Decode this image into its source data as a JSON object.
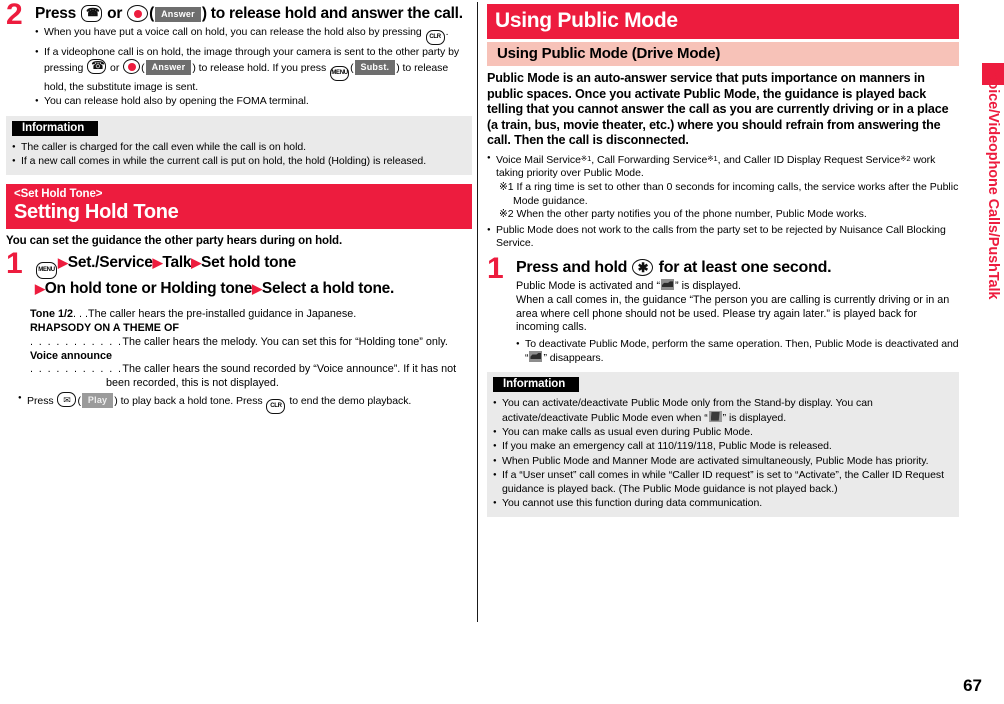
{
  "meta": {
    "page_number": "67",
    "edge_tab_label": "Voice/Videophone Calls/PushTalk",
    "accent_red": "#ED1C3E",
    "accent_pink": "#F7C2B8",
    "info_bg": "#EAEAEA",
    "chip_bg": "#6E6E6E"
  },
  "left": {
    "step2": {
      "number": "2",
      "title_a": "Press",
      "title_b": "or",
      "title_c": "(",
      "chip_answer": "Answer",
      "title_d": ") to release hold and answer the call.",
      "bullets": [
        {
          "part1": "When you have put a voice call on hold, you can release the hold also by pressing",
          "key": "CLR",
          "part2": "."
        },
        {
          "part1": "If a videophone call is on hold, the image through your camera is sent to the other party by pressing",
          "part2": "or",
          "chip1": "Answer",
          "part3": ") to release hold. If you press",
          "key_menu": "MENU",
          "chip2": "Subst.",
          "part4": ") to release hold, the substitute image is sent."
        },
        {
          "part1": "You can release hold also by opening the FOMA terminal."
        }
      ]
    },
    "information": {
      "label": "Information",
      "items": [
        "The caller is charged for the call even while the call is on hold.",
        "If a new call comes in while the current call is put on hold, the hold (Holding) is released."
      ]
    },
    "section": {
      "kicker": "<Set Hold Tone>",
      "title": "Setting Hold Tone",
      "lead": "You can set the guidance the other party hears during on hold.",
      "step1": {
        "number": "1",
        "key_menu": "MENU",
        "path": [
          "Set./Service",
          "Talk",
          "Set hold tone",
          "On hold tone or Holding tone",
          "Select a hold tone."
        ]
      },
      "definitions": [
        {
          "term": "Tone 1/2",
          "dots": ". . .",
          "desc": "The caller hears the pre-installed guidance in Japanese."
        },
        {
          "term": "RHAPSODY ON A THEME OF",
          "dots": ". . . . . . . . . . .",
          "desc": "The caller hears the melody. You can set this for “Holding tone” only."
        },
        {
          "term": "Voice announce",
          "dots": ". . . . . . . . . . .",
          "desc": "The caller hears the sound recorded by “Voice announce”. If it has not been recorded, this is not displayed."
        }
      ],
      "play_note": {
        "part1": "Press",
        "chip": "Play",
        "part2": ") to play back a hold tone. Press",
        "key": "CLR",
        "part3": "to end the demo playback."
      }
    }
  },
  "right": {
    "section_title": "Using Public Mode",
    "sub_title": "Using Public Mode (Drive Mode)",
    "lead": "Public Mode is an auto-answer service that puts importance on manners in public spaces. Once you activate Public Mode, the guidance is played back telling that you cannot answer the call as you are currently driving or in a place (a train, bus, movie theater, etc.) where you should refrain from answering the call. Then the call is disconnected.",
    "bullets": [
      {
        "text_a": "Voice Mail Service",
        "ref_a": "※1",
        "text_b": ", Call Forwarding Service",
        "ref_b": "※1",
        "text_c": ", and Caller ID Display Request Service",
        "ref_c": "※2",
        "text_d": " work taking priority over Public Mode."
      }
    ],
    "footnotes": [
      "※1 If a ring time is set to other than 0 seconds for incoming calls, the service works after the Public Mode guidance.",
      "※2 When the other party notifies you of the phone number, Public Mode works."
    ],
    "bullets2": [
      "Public Mode does not work to the calls from the party set to be rejected by Nuisance Call Blocking Service."
    ],
    "step1": {
      "number": "1",
      "title_a": "Press and hold",
      "key": "✳",
      "title_b": "for at least one second.",
      "body_a": "Public Mode is activated and “",
      "body_b": "” is displayed.",
      "body_c": "When a call comes in, the guidance “The person you are calling is currently driving or in an area where cell phone should not be used. Please try again later.” is played back for incoming calls.",
      "bullet_a": "To deactivate Public Mode, perform the same operation. Then, Public Mode is deactivated and “",
      "bullet_b": "” disappears."
    },
    "information": {
      "label": "Information",
      "items_pre": "You can activate/deactivate Public Mode only from the Stand-by display. You can activate/deactivate Public Mode even when “",
      "items_post": "” is displayed.",
      "items": [
        "You can make calls as usual even during Public Mode.",
        "If you make an emergency call at 110/119/118, Public Mode is released.",
        "When Public Mode and Manner Mode are activated simultaneously, Public Mode has priority.",
        "If a “User unset” call comes in while “Caller ID request” is set to “Activate”, the Caller ID Request guidance is played back. (The Public Mode guidance is not played back.)",
        "You cannot use this function during data communication."
      ]
    }
  }
}
